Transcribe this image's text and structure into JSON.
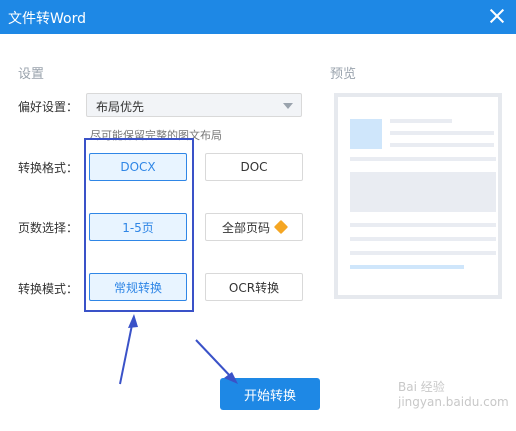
{
  "window": {
    "title": "文件转Word"
  },
  "settings": {
    "section_title": "设置",
    "preference": {
      "label": "偏好设置：",
      "selected": "布局优先",
      "hint": "尽可能保留完整的图文布局"
    },
    "format": {
      "label": "转换格式：",
      "options": [
        "DOCX",
        "DOC"
      ],
      "selected": "DOCX"
    },
    "pages": {
      "label": "页数选择：",
      "options": [
        "1-5页",
        "全部页码"
      ],
      "selected": "1-5页"
    },
    "mode": {
      "label": "转换模式：",
      "options": [
        "常规转换",
        "OCR转换"
      ],
      "selected": "常规转换"
    }
  },
  "preview": {
    "section_title": "预览"
  },
  "actions": {
    "start_label": "开始转换"
  },
  "watermark": "Bai 经验 jingyan.baidu.com",
  "icons": {
    "close": "close-icon",
    "dropdown": "chevron-down-icon",
    "vip": "diamond-icon"
  },
  "colors": {
    "accent": "#1e88e5",
    "selected_bg": "#e8f4ff",
    "annotation": "#3a52c8",
    "vip": "#f5a623"
  }
}
